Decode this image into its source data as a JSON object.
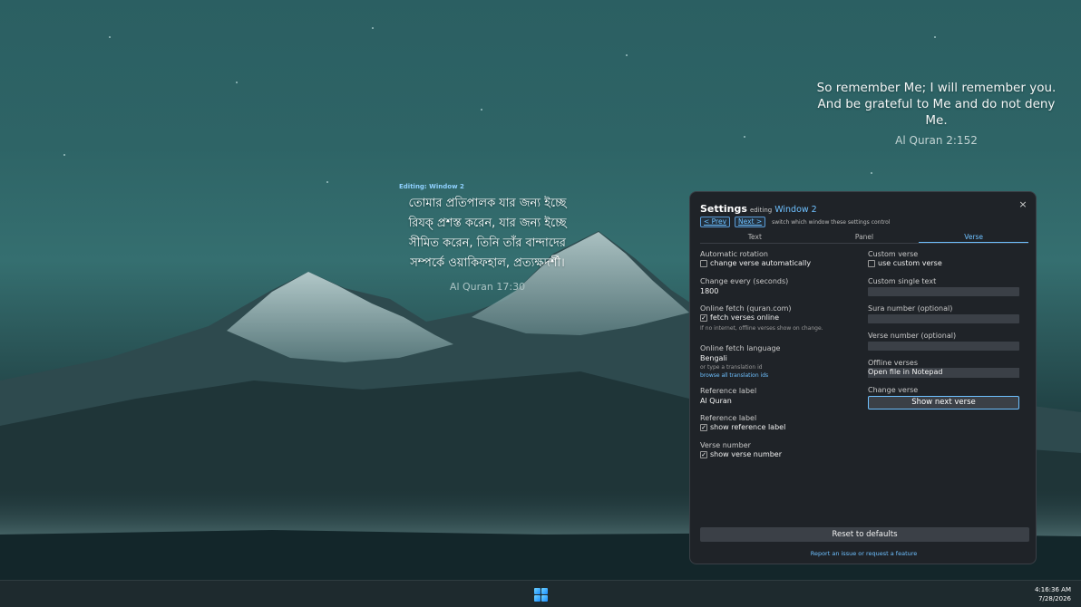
{
  "verse_en": {
    "text": "So remember Me; I will remember you. And be grateful to Me and do not deny Me.",
    "reference": "Al Quran 2:152"
  },
  "verse_bn": {
    "editing_tag": "Editing: Window 2",
    "text": "তোমার প্রতিপালক যার জন্য ইচ্ছে রিযক্ প্রশস্ত করেন, যার জন্য ইচ্ছে সীমিত করেন, তিনি তাঁর বান্দাদের সম্পর্কে ওয়াকিফহাল, প্রত্যক্ষদর্শী।",
    "reference": "Al Quran 17:30"
  },
  "settings": {
    "title": "Settings",
    "editing_word": "editing",
    "window_name": "Window 2",
    "close_icon": "×",
    "prev_label": "< Prev",
    "next_label": "Next >",
    "nav_hint": "switch which window these settings control",
    "tabs": [
      {
        "label": "Text",
        "active": false
      },
      {
        "label": "Panel",
        "active": false
      },
      {
        "label": "Verse",
        "active": true
      }
    ],
    "left": {
      "auto_rotation_label": "Automatic rotation",
      "auto_rotation_check": "change verse automatically",
      "auto_rotation_checked": false,
      "change_every_label": "Change every (seconds)",
      "change_every_value": "1800",
      "online_fetch_label": "Online fetch (quran.com)",
      "online_fetch_check": "fetch verses online",
      "online_fetch_checked": true,
      "online_fetch_note": "If no internet, offline verses show on change.",
      "fetch_language_label": "Online fetch language",
      "fetch_language_value": "Bengali",
      "fetch_language_note": "or type a translation id",
      "fetch_language_link": "browse all translation ids",
      "ref_label_label": "Reference label",
      "ref_label_value": "Al Quran",
      "show_ref_label": "Reference label",
      "show_ref_check": "show reference label",
      "show_ref_checked": true,
      "verse_number_label": "Verse number",
      "verse_number_check": "show verse number",
      "verse_number_checked": true
    },
    "right": {
      "custom_verse_label": "Custom verse",
      "custom_verse_check": "use custom verse",
      "custom_verse_checked": false,
      "custom_single_label": "Custom single text",
      "custom_single_value": "",
      "sura_label": "Sura number (optional)",
      "sura_value": "",
      "verse_num_label": "Verse number (optional)",
      "verse_num_value": "",
      "offline_label": "Offline verses",
      "offline_value": "Open file in Notepad",
      "change_verse_label": "Change verse",
      "show_next_label": "Show next verse"
    },
    "reset_label": "Reset to defaults",
    "report_label": "Report an issue or request a feature"
  },
  "taskbar": {
    "time": "4:16:36 AM",
    "date": "7/28/2026",
    "start_icon": "windows-logo"
  }
}
